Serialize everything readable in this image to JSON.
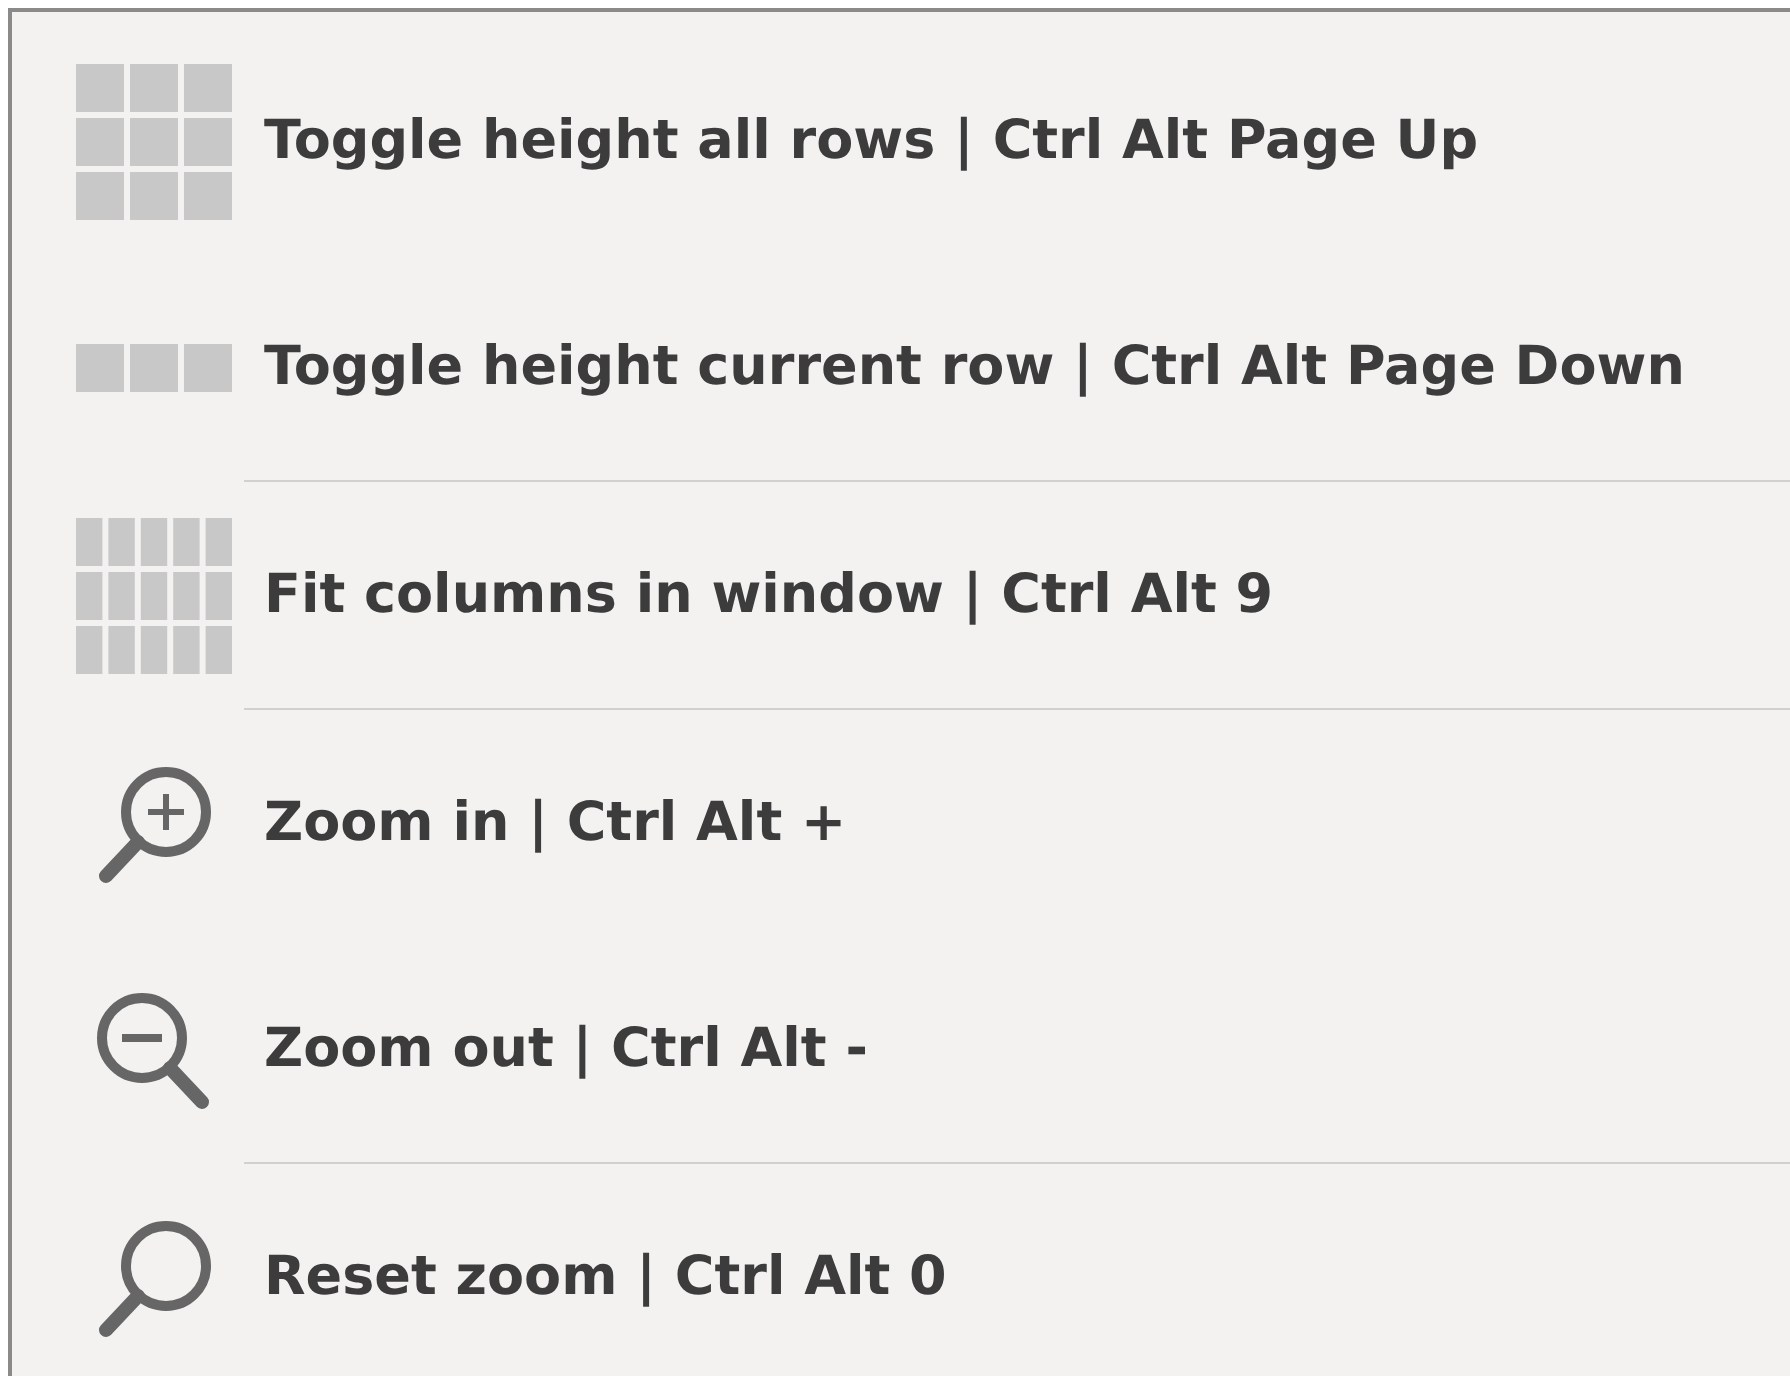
{
  "menu": {
    "items": [
      {
        "kind": "grid",
        "label": "Toggle height all rows | Ctrl Alt Page Up"
      },
      {
        "kind": "row",
        "label": "Toggle height current row | Ctrl Alt Page Down"
      },
      {
        "kind": "separator"
      },
      {
        "kind": "columns",
        "label": "Fit columns in window | Ctrl Alt 9"
      },
      {
        "kind": "separator"
      },
      {
        "kind": "zoom-in",
        "label": "Zoom in | Ctrl Alt +"
      },
      {
        "kind": "zoom-out",
        "label": "Zoom out | Ctrl Alt -"
      },
      {
        "kind": "separator"
      },
      {
        "kind": "magnifier",
        "label": "Reset zoom | Ctrl Alt 0"
      }
    ]
  }
}
